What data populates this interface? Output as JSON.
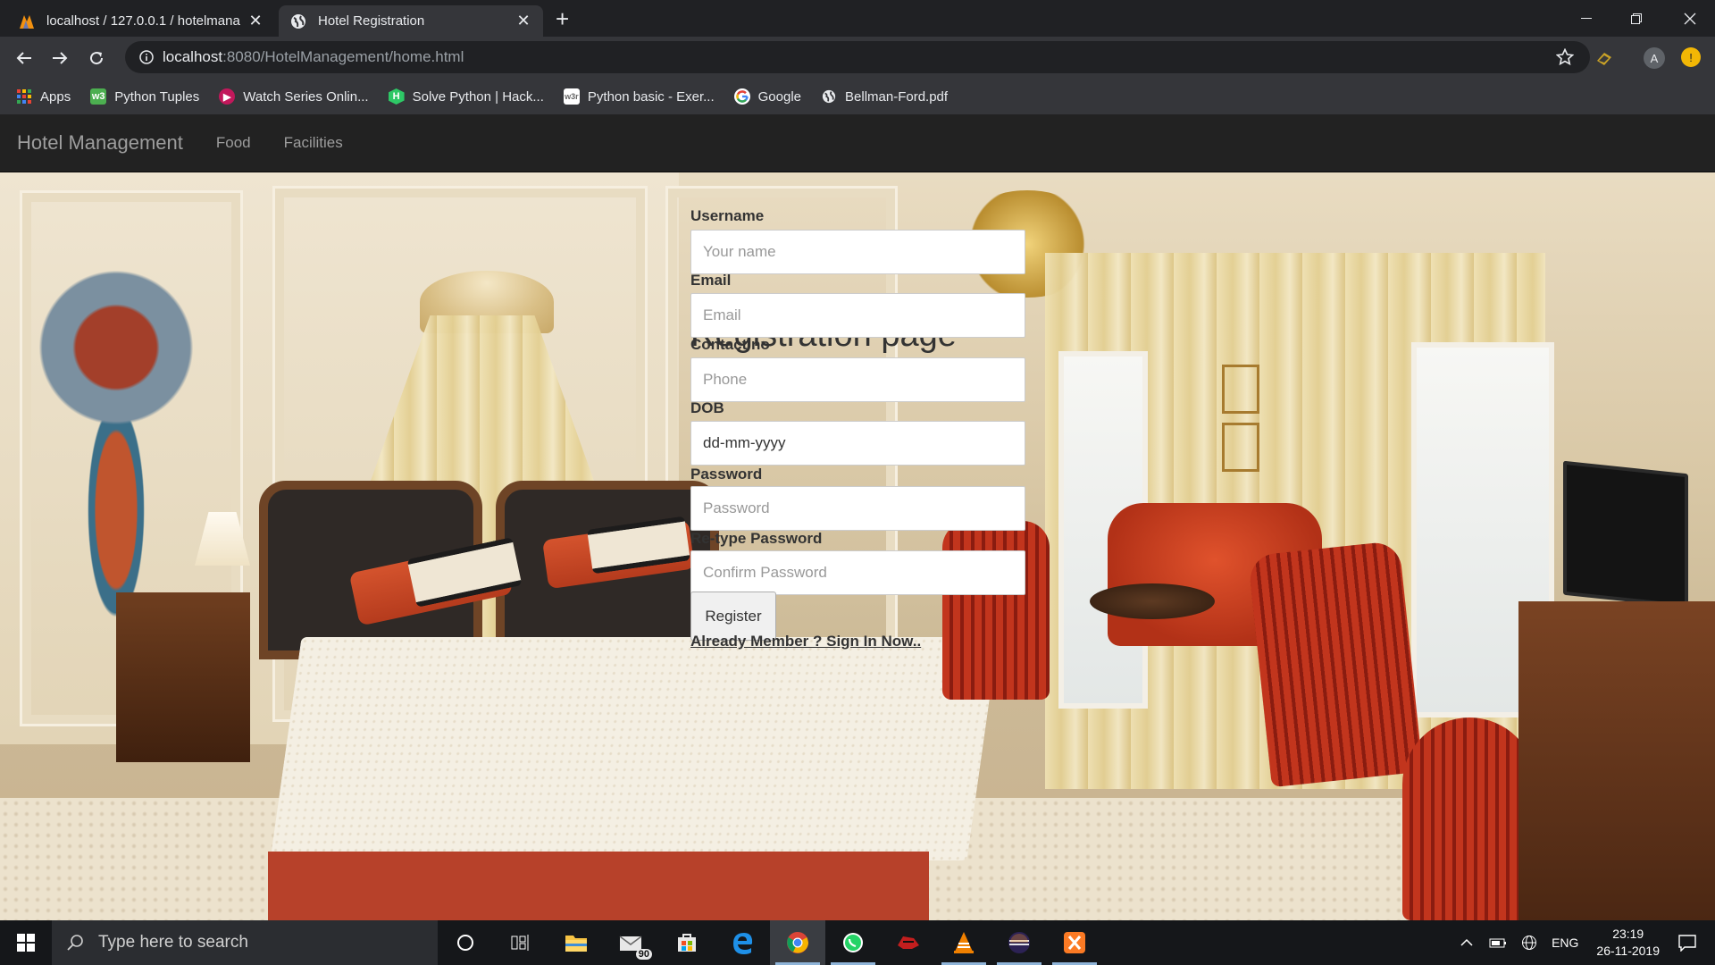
{
  "browser": {
    "tabs": [
      {
        "title": "localhost / 127.0.0.1 / hotelmana",
        "active": false,
        "icon": "phpmyadmin-icon"
      },
      {
        "title": "Hotel Registration",
        "active": true,
        "icon": "globe-icon"
      }
    ],
    "url_host": "localhost",
    "url_path": ":8080/HotelManagement/home.html",
    "profile_initial": "A",
    "bookmarks": [
      {
        "label": "Apps",
        "icon": "apps-grid-icon",
        "color": "#4285f4"
      },
      {
        "label": "Python Tuples",
        "icon": "w3-icon",
        "color": "#4caf50"
      },
      {
        "label": "Watch Series Onlin...",
        "icon": "play-icon",
        "color": "#c2185b"
      },
      {
        "label": "Solve Python | Hack...",
        "icon": "hackerrank-icon",
        "color": "#2ec866"
      },
      {
        "label": "Python basic - Exer...",
        "icon": "w3r-icon",
        "color": "#ffffff"
      },
      {
        "label": "Google",
        "icon": "google-icon",
        "color": "#ffffff"
      },
      {
        "label": "Bellman-Ford.pdf",
        "icon": "globe-icon",
        "color": "#ffffff"
      }
    ]
  },
  "navbar": {
    "brand": "Hotel Management",
    "links": [
      "Food",
      "Facilities"
    ]
  },
  "form": {
    "title": "Registration page",
    "username_label": "Username",
    "username_placeholder": "Your name",
    "email_label": "Email",
    "email_placeholder": "Email",
    "contact_label": "Contact no",
    "contact_placeholder": "Phone",
    "dob_label": "DOB",
    "dob_value": "dd-mm-yyyy",
    "password_label": "Password",
    "password_placeholder": "Password",
    "retype_label": "Re-type Password",
    "retype_placeholder": "Confirm Password",
    "register_button": "Register",
    "signin_link": "Already Member ? Sign In Now.."
  },
  "taskbar": {
    "search_placeholder": "Type here to search",
    "mail_badge": "90",
    "language": "ENG",
    "time": "23:19",
    "date": "26-11-2019"
  },
  "colors": {
    "navbar_bg": "#222222",
    "navbar_text": "#9d9d9d",
    "chrome_dark": "#202124",
    "chrome_mid": "#35363a"
  }
}
